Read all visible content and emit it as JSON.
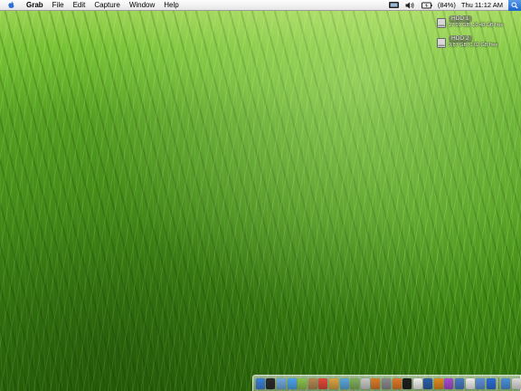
{
  "menubar": {
    "apple_icon": "apple-icon",
    "app_name": "Grab",
    "menus": [
      "File",
      "Edit",
      "Capture",
      "Window",
      "Help"
    ],
    "status": {
      "display_icon": "display-icon",
      "volume_icon": "volume-icon",
      "battery_icon": "battery-icon",
      "battery_percent": "(84%)",
      "clock": "Thu 11:12 AM",
      "spotlight_icon": "spotlight-icon"
    }
  },
  "desktop": {
    "volumes": [
      {
        "name": "HDD 1",
        "info": "27.01 GB, 10.48 GB free",
        "icon": "hard-drive-icon"
      },
      {
        "name": "HDD 2",
        "info": "9.87 GB, 0.02 GB free",
        "icon": "hard-drive-icon"
      }
    ]
  },
  "dock": {
    "apps": [
      {
        "icon": "finder-icon",
        "color": "#3d7fd6"
      },
      {
        "icon": "dashboard-icon",
        "color": "#2b2b2b"
      },
      {
        "icon": "mail-icon",
        "color": "#6fa8dc"
      },
      {
        "icon": "safari-icon",
        "color": "#4aa3e8"
      },
      {
        "icon": "ichat-icon",
        "color": "#8bc34a"
      },
      {
        "icon": "address-book-icon",
        "color": "#b5884f"
      },
      {
        "icon": "ical-icon",
        "color": "#e04a3a"
      },
      {
        "icon": "preview-icon",
        "color": "#d9a441"
      },
      {
        "icon": "itunes-icon",
        "color": "#5aa7d9"
      },
      {
        "icon": "iphoto-icon",
        "color": "#7fb05a"
      },
      {
        "icon": "imovie-icon",
        "color": "#c9c9c9"
      },
      {
        "icon": "garageband-icon",
        "color": "#d97b2b"
      },
      {
        "icon": "system-preferences-icon",
        "color": "#8a8a8a"
      },
      {
        "icon": "firefox-icon",
        "color": "#e0782a"
      },
      {
        "icon": "terminal-icon",
        "color": "#1f1f1f"
      },
      {
        "icon": "textedit-icon",
        "color": "#f0f0f0"
      },
      {
        "icon": "photoshop-icon",
        "color": "#2d5fa6"
      },
      {
        "icon": "illustrator-icon",
        "color": "#e08a1e"
      },
      {
        "icon": "itunes-store-icon",
        "color": "#a74bd1"
      },
      {
        "icon": "network-icon",
        "color": "#4a79c4"
      },
      {
        "icon": "app-icon",
        "color": "#eeeeee"
      },
      {
        "icon": "app-icon",
        "color": "#5c8fd8"
      },
      {
        "icon": "quicktime-icon",
        "color": "#2d6bd4"
      }
    ],
    "docs": [
      {
        "icon": "app-icon",
        "color": "#4c8ed8"
      },
      {
        "icon": "app-icon",
        "color": "#dcdcdc"
      },
      {
        "icon": "app-icon",
        "color": "#7fa7d8"
      },
      {
        "icon": "app-icon",
        "color": "#cfcfcf"
      }
    ],
    "trash_icon": "trash-icon"
  }
}
